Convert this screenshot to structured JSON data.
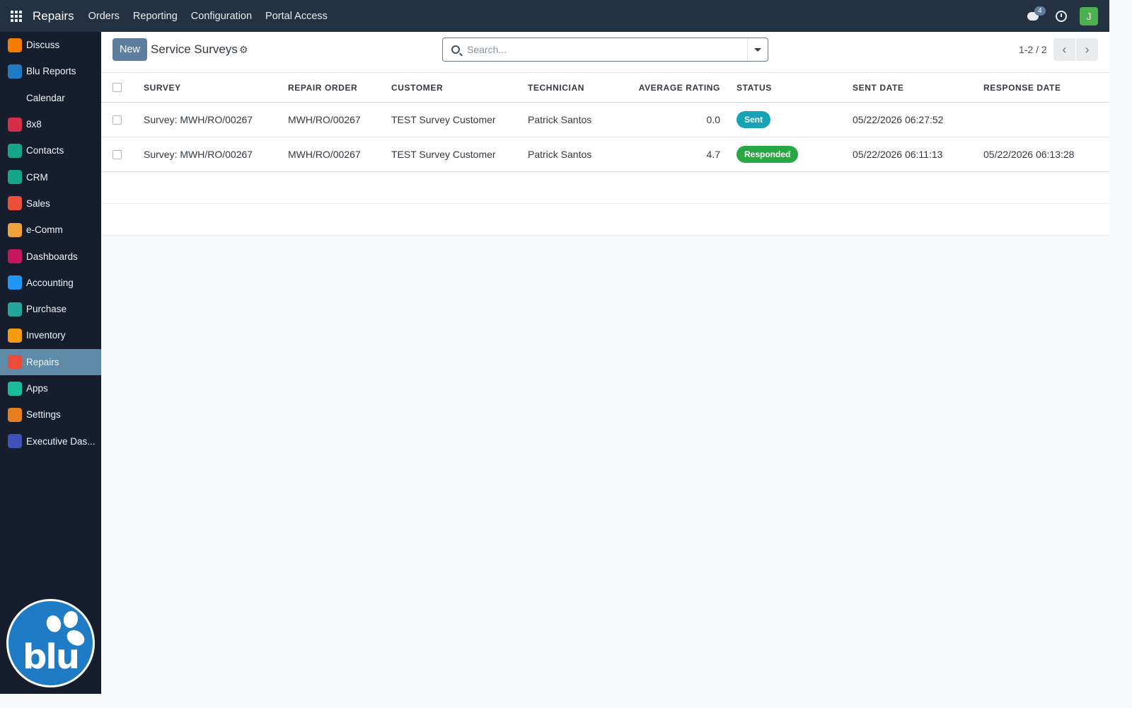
{
  "topbar": {
    "app_name": "Repairs",
    "menu": [
      "Orders",
      "Reporting",
      "Configuration",
      "Portal Access"
    ],
    "messages_count": "4",
    "user_initial": "J"
  },
  "sidebar": {
    "items": [
      {
        "label": "Discuss",
        "icon": "discuss-icon",
        "color": "#f57c00"
      },
      {
        "label": "Blu Reports",
        "icon": "blu-reports-icon",
        "color": "#1f7cc4"
      },
      {
        "label": "Calendar",
        "icon": "calendar-icon",
        "color": "#161e2d"
      },
      {
        "label": "8x8",
        "icon": "8x8-icon",
        "color": "#d32f4a"
      },
      {
        "label": "Contacts",
        "icon": "contacts-icon",
        "color": "#17a589"
      },
      {
        "label": "CRM",
        "icon": "crm-icon",
        "color": "#17a589"
      },
      {
        "label": "Sales",
        "icon": "sales-icon",
        "color": "#e94f3b"
      },
      {
        "label": "e-Comm",
        "icon": "ecomm-icon",
        "color": "#f0a33a"
      },
      {
        "label": "Dashboards",
        "icon": "dashboards-icon",
        "color": "#c2185b"
      },
      {
        "label": "Accounting",
        "icon": "accounting-icon",
        "color": "#2196f3"
      },
      {
        "label": "Purchase",
        "icon": "purchase-icon",
        "color": "#26a69a"
      },
      {
        "label": "Inventory",
        "icon": "inventory-icon",
        "color": "#f39c12"
      },
      {
        "label": "Repairs",
        "icon": "repairs-icon",
        "color": "#e74c3c",
        "active": true
      },
      {
        "label": "Apps",
        "icon": "apps-icon",
        "color": "#1abc9c"
      },
      {
        "label": "Settings",
        "icon": "settings-icon",
        "color": "#e67e22"
      },
      {
        "label": "Executive Das...",
        "icon": "executive-dashboard-icon",
        "color": "#3f51b5"
      }
    ],
    "logo_text": "blu"
  },
  "control": {
    "new_label": "New",
    "title": "Service Surveys",
    "search_placeholder": "Search...",
    "pager": "1-2 / 2"
  },
  "table": {
    "headers": [
      "SURVEY",
      "REPAIR ORDER",
      "CUSTOMER",
      "TECHNICIAN",
      "AVERAGE RATING",
      "STATUS",
      "SENT DATE",
      "RESPONSE DATE"
    ],
    "rows": [
      {
        "survey": "Survey: MWH/RO/00267",
        "repair_order": "MWH/RO/00267",
        "customer": "TEST Survey Customer",
        "technician": "Patrick Santos",
        "rating": "0.0",
        "status": "Sent",
        "sent_date": "05/22/2026 06:27:52",
        "response_date": ""
      },
      {
        "survey": "Survey: MWH/RO/00267",
        "repair_order": "MWH/RO/00267",
        "customer": "TEST Survey Customer",
        "technician": "Patrick Santos",
        "rating": "4.7",
        "status": "Responded",
        "sent_date": "05/22/2026 06:11:13",
        "response_date": "05/22/2026 06:13:28"
      }
    ]
  },
  "colors": {
    "topbar": "#233140",
    "sidebar": "#161e2d",
    "primary": "#5e7ea0",
    "status_sent": "#17a2b8",
    "status_responded": "#28a745"
  }
}
